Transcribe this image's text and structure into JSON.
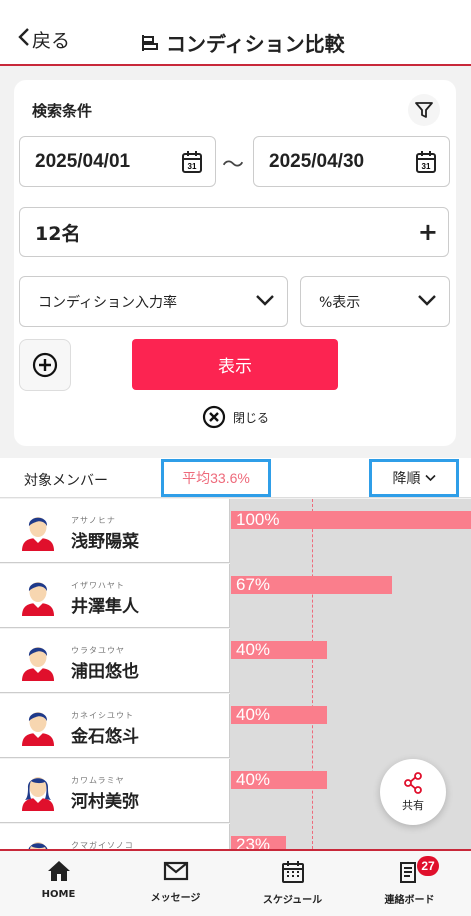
{
  "header": {
    "back_label": "戻る",
    "title": "コンディション比較"
  },
  "search": {
    "title": "検索条件",
    "start_date": "2025/04/01",
    "separator": "〜",
    "end_date": "2025/04/30",
    "members_label": "12名",
    "metric_select": "コンディション入力率",
    "display_select": "%表示",
    "show_button": "表示",
    "close_label": "閉じる"
  },
  "list": {
    "target_label": "対象メンバー",
    "average_label": "平均33.6%",
    "sort_label": "降順",
    "average_value": 33.6,
    "members": [
      {
        "kana": "アサノヒナ",
        "name": "浅野陽菜",
        "value": 100,
        "label": "100%"
      },
      {
        "kana": "イザワハヤト",
        "name": "井澤隼人",
        "value": 67,
        "label": "67%"
      },
      {
        "kana": "ウラタユウヤ",
        "name": "浦田悠也",
        "value": 40,
        "label": "40%"
      },
      {
        "kana": "カネイシユウト",
        "name": "金石悠斗",
        "value": 40,
        "label": "40%"
      },
      {
        "kana": "カワムラミヤ",
        "name": "河村美弥",
        "value": 40,
        "label": "40%"
      },
      {
        "kana": "クマガイソノコ",
        "name": "",
        "value": 23,
        "label": "23%"
      }
    ]
  },
  "share": {
    "label": "共有"
  },
  "tabs": [
    {
      "label": "HOME",
      "icon": "home-icon"
    },
    {
      "label": "メッセージ",
      "icon": "mail-icon"
    },
    {
      "label": "スケジュール",
      "icon": "calendar-icon"
    },
    {
      "label": "連絡ボード",
      "icon": "board-icon",
      "badge": "27"
    }
  ],
  "colors": {
    "accent": "#fc2451",
    "bar": "#fa7e8c",
    "highlight": "#2f9ee8",
    "header_line": "#c8283a"
  }
}
